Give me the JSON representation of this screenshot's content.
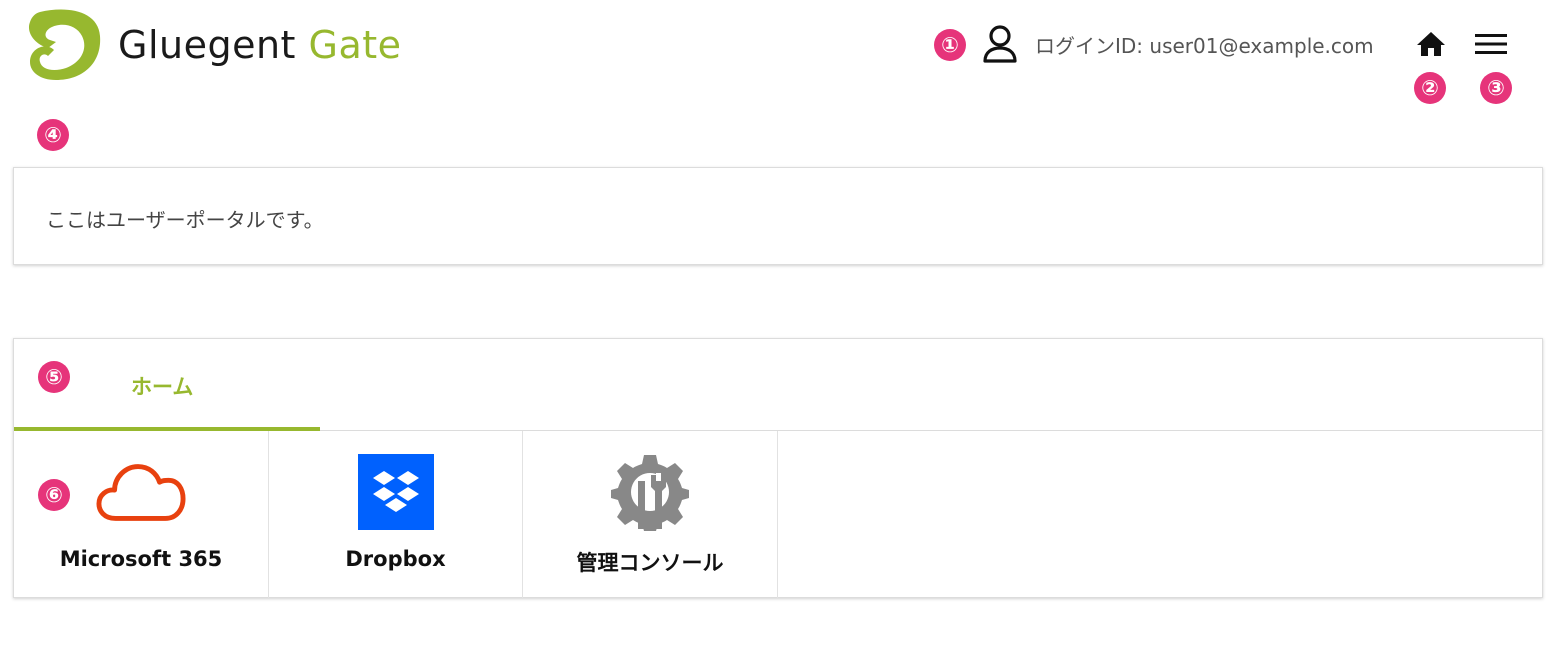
{
  "header": {
    "logo_word1": "Gluegent",
    "logo_word2": "Gate",
    "login_text": "ログインID: user01@example.com",
    "icons": [
      "user-icon",
      "home-icon",
      "hamburger-menu-icon"
    ]
  },
  "markers": [
    "①",
    "②",
    "③",
    "④",
    "⑤",
    "⑥"
  ],
  "notice": {
    "text": "ここはユーザーポータルです。"
  },
  "portal": {
    "tabs": [
      {
        "label": "ホーム",
        "active": true
      }
    ],
    "apps": [
      {
        "label": "Microsoft 365",
        "icon": "cloud-icon"
      },
      {
        "label": "Dropbox",
        "icon": "dropbox-icon"
      },
      {
        "label": "管理コンソール",
        "icon": "admin-gear-icon"
      }
    ]
  },
  "colors": {
    "brand_green": "#97b82f",
    "marker_pink": "#e6347a",
    "dropbox_blue": "#0061fe",
    "cloud_orange": "#e8410f",
    "gear_gray": "#888888"
  }
}
